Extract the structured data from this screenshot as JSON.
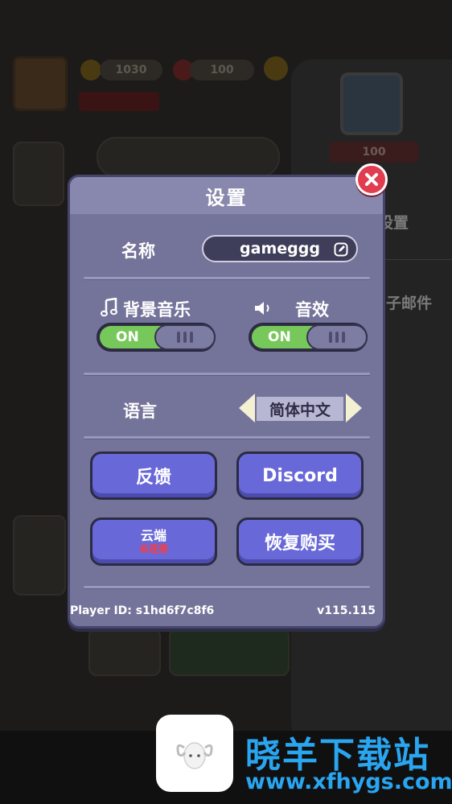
{
  "background": {
    "coins_value": "1030",
    "gems_value": "100",
    "level_badge": "100",
    "right_menu": [
      "设置",
      "子邮件"
    ]
  },
  "settings": {
    "title": "设置",
    "name_label": "名称",
    "name_value": "gameggg",
    "music_label": "背景音乐",
    "music_state": "ON",
    "sfx_label": "音效",
    "sfx_state": "ON",
    "language_label": "语言",
    "language_value": "简体中文",
    "feedback_button": "反馈",
    "discord_button": "Discord",
    "cloud_button": "云端",
    "cloud_status": "未连接",
    "restore_button": "恢复购买",
    "player_id": "Player ID: s1hd6f7c8f6",
    "version": "v115.115"
  },
  "watermark": {
    "title": "晓羊下载站",
    "url": "www.xfhygs.com"
  },
  "colors": {
    "panel": "#74739a",
    "toggle_on": "#76c85a",
    "button": "#6868d8",
    "close": "#e23c50",
    "watermark": "#2aa5f0"
  }
}
